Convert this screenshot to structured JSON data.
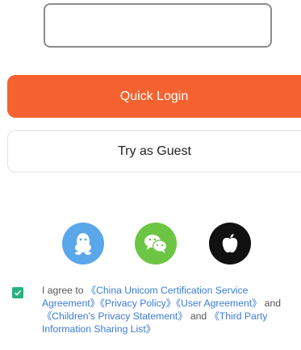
{
  "login": {
    "phone_input": {
      "value": "",
      "placeholder": ""
    },
    "quick_login_label": "Quick Login",
    "guest_label": "Try as Guest"
  },
  "social": {
    "items": [
      {
        "icon": "qq-icon",
        "color": "#5aa7ea"
      },
      {
        "icon": "wechat-icon",
        "color": "#6cc644"
      },
      {
        "icon": "apple-icon",
        "color": "#111111"
      }
    ]
  },
  "agreement": {
    "checked": true,
    "prefix": "I agree to ",
    "link_1": "《China Unicom Certification Service Agreement》",
    "link_2": "《Privacy Policy》",
    "link_3": "《User Agreement》",
    "and_1": " and ",
    "link_4": "《Children's Privacy Statement》",
    "and_2": " and ",
    "link_5": "《Third Party Information Sharing List》"
  },
  "colors": {
    "accent": "#f5622f",
    "checkbox": "#26b37d",
    "link": "#3a7bd5"
  }
}
